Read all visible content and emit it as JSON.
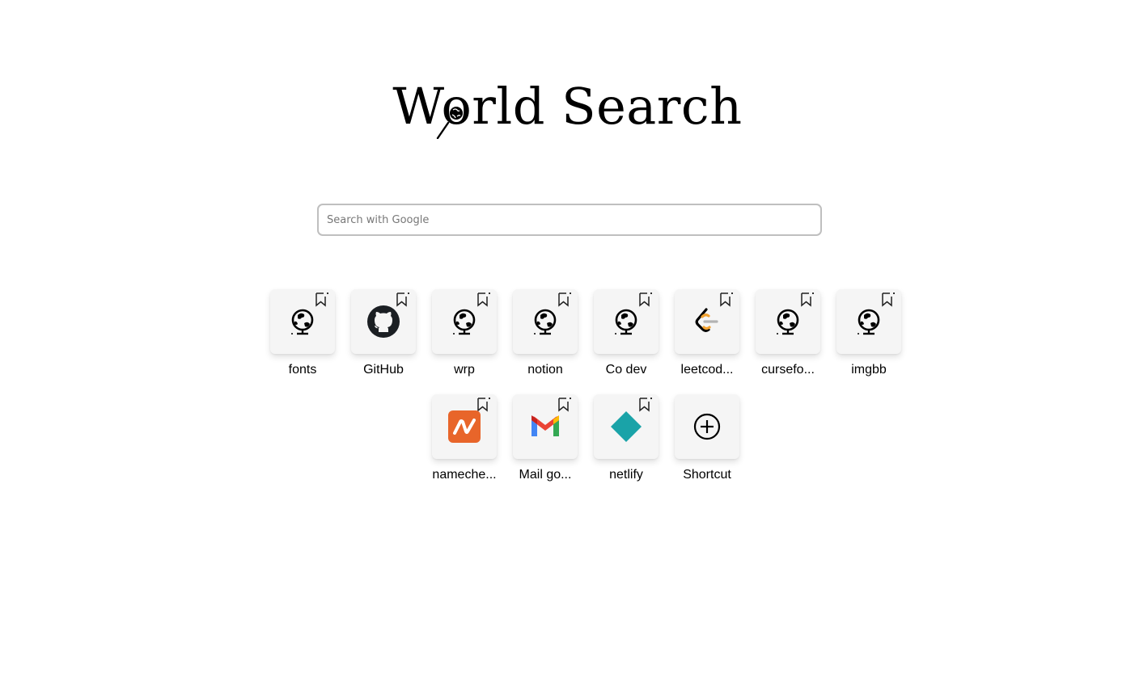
{
  "logo": {
    "title": "World Search"
  },
  "search": {
    "placeholder": "Search with Google"
  },
  "shortcuts": [
    {
      "label": "fonts",
      "icon": "globe-icon"
    },
    {
      "label": "GitHub",
      "icon": "github-icon"
    },
    {
      "label": "wrp",
      "icon": "globe-icon"
    },
    {
      "label": "notion",
      "icon": "globe-icon"
    },
    {
      "label": "Co dev",
      "icon": "globe-icon"
    },
    {
      "label": "leetcod...",
      "icon": "leetcode-icon"
    },
    {
      "label": "cursefo...",
      "icon": "globe-icon"
    },
    {
      "label": "imgbb",
      "icon": "globe-icon"
    },
    {
      "label": "nameche...",
      "icon": "namecheap-icon"
    },
    {
      "label": "Mail go...",
      "icon": "gmail-icon"
    },
    {
      "label": "netlify",
      "icon": "netlify-icon"
    }
  ],
  "add_shortcut": {
    "label": "Shortcut",
    "icon": "plus-circle-icon"
  },
  "colors": {
    "namecheap": "#e8652a",
    "netlify": "#1aa3a8",
    "leetcode_orange": "#f1a231",
    "leetcode_gray": "#b3b3b3"
  }
}
